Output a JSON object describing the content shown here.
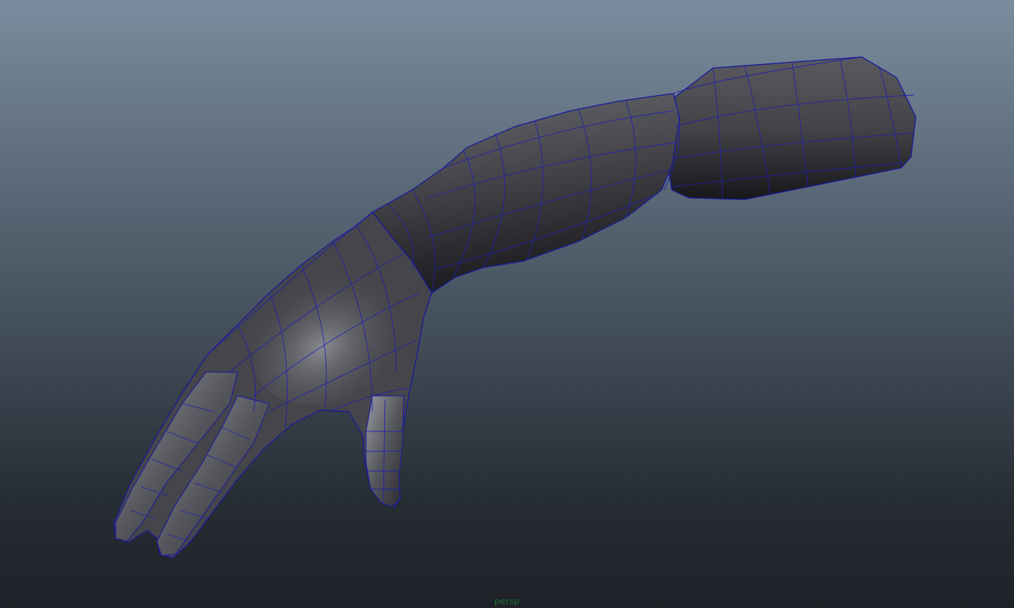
{
  "viewport": {
    "camera_label": "persp",
    "background_top_color": "#7a8c9e",
    "background_bottom_color": "#1e2228"
  },
  "model": {
    "shading": "smooth-shade-with-wireframe",
    "surface_color": "#4a4a4f",
    "wireframe_color": "#1a1a9a"
  }
}
